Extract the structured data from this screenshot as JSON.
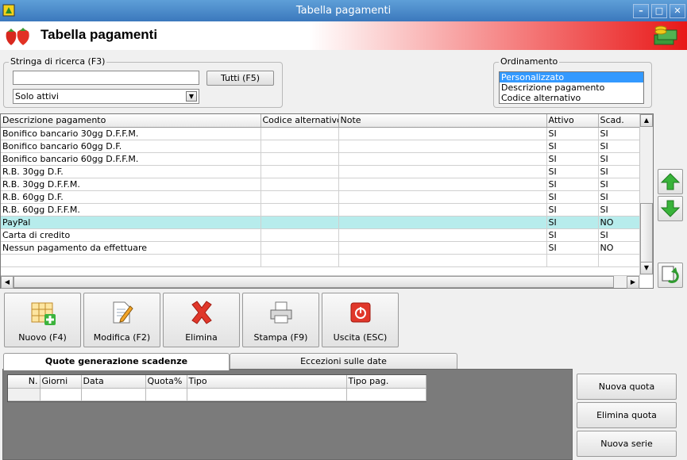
{
  "window": {
    "title": "Tabella pagamenti"
  },
  "header": {
    "title": "Tabella pagamenti"
  },
  "search": {
    "group_label": "Stringa di ricerca (F3)",
    "value": "",
    "all_button": "Tutti (F5)",
    "filter_selected": "Solo attivi"
  },
  "ordering": {
    "group_label": "Ordinamento",
    "options": [
      "Personalizzato",
      "Descrizione pagamento",
      "Codice alternativo"
    ],
    "selected_index": 0
  },
  "table": {
    "columns": [
      "Descrizione pagamento",
      "Codice alternativo",
      "Note",
      "Attivo",
      "Scad."
    ],
    "rows": [
      [
        "Bonifico bancario 30gg D.F.F.M.",
        "",
        "",
        "SI",
        "SI"
      ],
      [
        "Bonifico bancario 60gg D.F.",
        "",
        "",
        "SI",
        "SI"
      ],
      [
        "Bonifico bancario 60gg D.F.F.M.",
        "",
        "",
        "SI",
        "SI"
      ],
      [
        "R.B. 30gg D.F.",
        "",
        "",
        "SI",
        "SI"
      ],
      [
        "R.B. 30gg D.F.F.M.",
        "",
        "",
        "SI",
        "SI"
      ],
      [
        "R.B. 60gg D.F.",
        "",
        "",
        "SI",
        "SI"
      ],
      [
        "R.B. 60gg D.F.F.M.",
        "",
        "",
        "SI",
        "SI"
      ],
      [
        "PayPal",
        "",
        "",
        "SI",
        "NO"
      ],
      [
        "Carta di credito",
        "",
        "",
        "SI",
        "SI"
      ],
      [
        "Nessun pagamento da effettuare",
        "",
        "",
        "SI",
        "NO"
      ]
    ],
    "selected_row": 7
  },
  "toolbar": {
    "new": "Nuovo (F4)",
    "edit": "Modifica (F2)",
    "delete": "Elimina",
    "print": "Stampa (F9)",
    "exit": "Uscita (ESC)"
  },
  "tabs": [
    "Quote generazione scadenze",
    "Eccezioni sulle date"
  ],
  "subtable": {
    "columns": [
      "N.",
      "Giorni",
      "Data",
      "Quota%",
      "Tipo",
      "Tipo pag."
    ]
  },
  "side_buttons": {
    "new_quota": "Nuova quota",
    "delete_quota": "Elimina quota",
    "new_series": "Nuova serie"
  },
  "colors": {
    "selected_row": "#b7ecec",
    "header_accent": "#e81818",
    "title_bar": "#3b78bd"
  }
}
